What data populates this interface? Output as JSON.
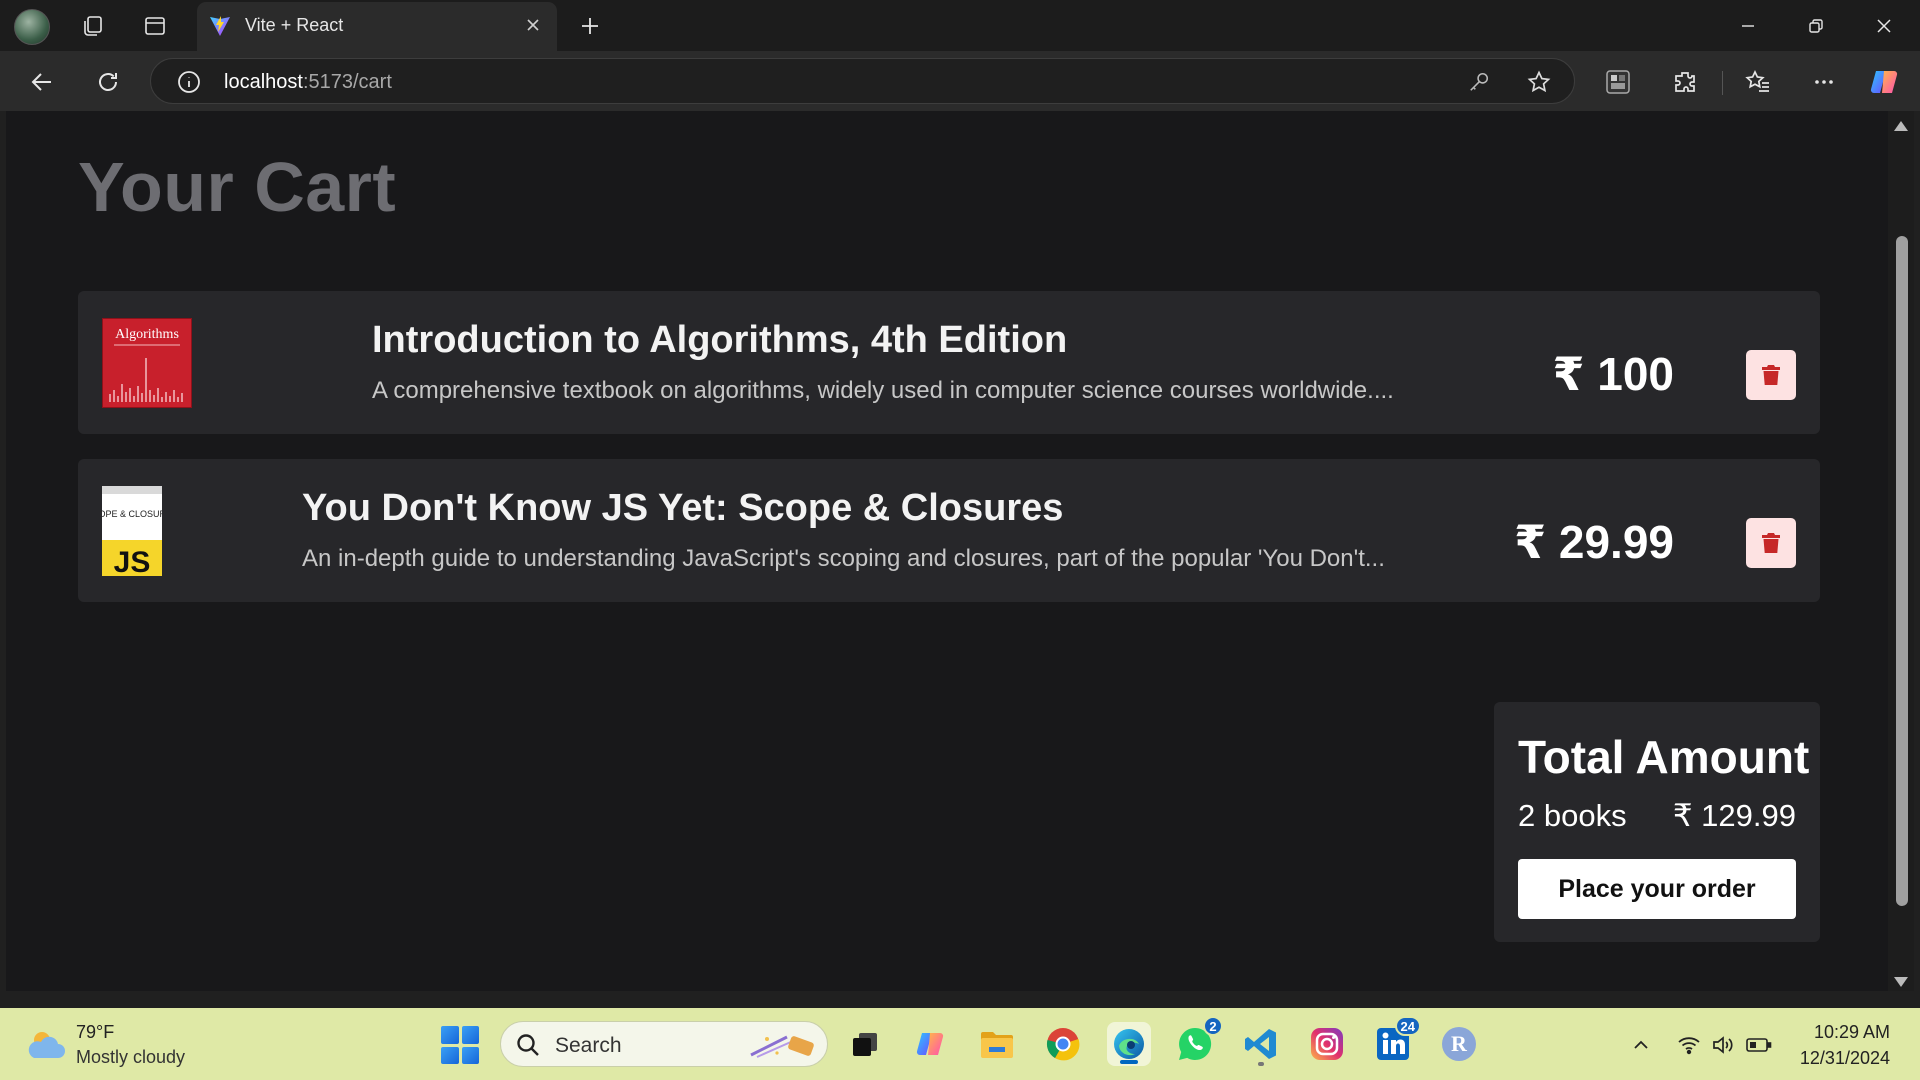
{
  "browser": {
    "tab_title": "Vite + React",
    "url_host": "localhost",
    "url_path": ":5173/cart"
  },
  "page": {
    "title": "Your Cart"
  },
  "cart": {
    "items": [
      {
        "title": "Introduction to Algorithms, 4th Edition",
        "description": "A comprehensive textbook on algorithms, widely used in computer science courses worldwide....",
        "price": "₹ 100",
        "cover_text": "Algorithms"
      },
      {
        "title": "You Don't Know JS Yet: Scope & Closures",
        "description": "An in-depth guide to understanding JavaScript's scoping and closures, part of the popular 'You Don't...",
        "price": "₹ 29.99",
        "cover_text_top": "SCOPE & CLOSURES",
        "cover_text_big": "JS"
      }
    ]
  },
  "summary": {
    "title": "Total Amount",
    "count": "2 books",
    "total": "₹ 129.99",
    "order_button": "Place your order"
  },
  "taskbar": {
    "weather_temp": "79°F",
    "weather_condition": "Mostly cloudy",
    "search_placeholder": "Search",
    "whatsapp_badge": "2",
    "linkedin_badge": "24",
    "profile_letter": "R",
    "time": "10:29 AM",
    "date": "12/31/2024"
  },
  "colors": {
    "delete_button_bg": "#fde2e2",
    "delete_icon": "#c62828",
    "page_bg": "#18181a",
    "card_bg": "#27272a"
  }
}
